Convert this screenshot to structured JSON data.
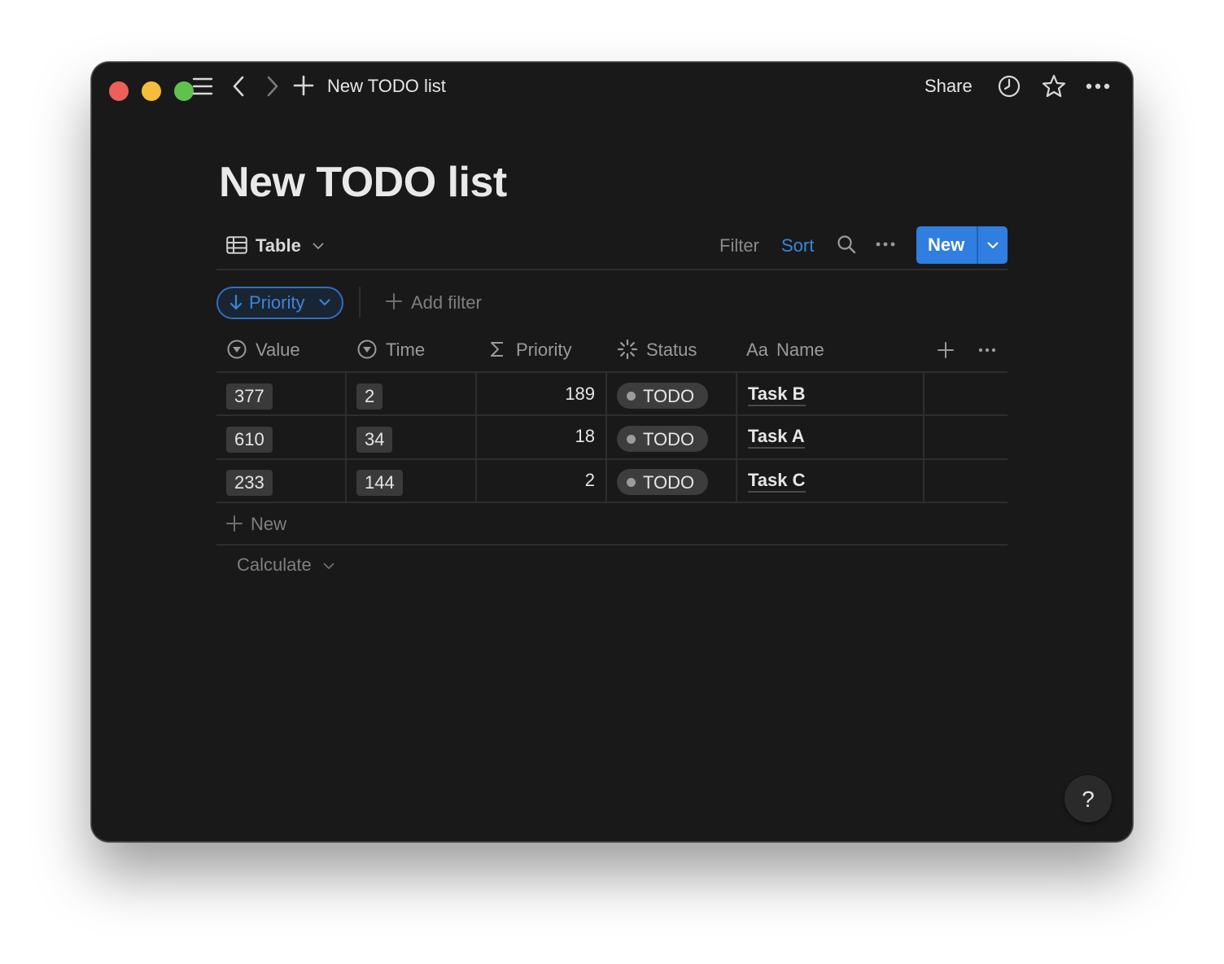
{
  "window": {
    "title": "New TODO list"
  },
  "titlebar": {
    "share_label": "Share"
  },
  "page": {
    "title": "New TODO list"
  },
  "view": {
    "label": "Table"
  },
  "toolbar": {
    "filter_label": "Filter",
    "sort_label": "Sort",
    "new_label": "New"
  },
  "sort_rule": {
    "label": "Priority",
    "direction": "descending"
  },
  "add_filter_label": "Add filter",
  "columns": [
    {
      "label": "Value",
      "icon": "formula-circle-icon"
    },
    {
      "label": "Time",
      "icon": "formula-circle-icon"
    },
    {
      "label": "Priority",
      "icon": "sigma-icon"
    },
    {
      "label": "Status",
      "icon": "status-spinner-icon"
    },
    {
      "label": "Name",
      "icon": "text-aa-icon",
      "icon_text": "Aa"
    }
  ],
  "rows": [
    {
      "value": "377",
      "time": "2",
      "priority": "189",
      "status": "TODO",
      "name": "Task B"
    },
    {
      "value": "610",
      "time": "34",
      "priority": "18",
      "status": "TODO",
      "name": "Task A"
    },
    {
      "value": "233",
      "time": "144",
      "priority": "2",
      "status": "TODO",
      "name": "Task C"
    }
  ],
  "new_row_label": "New",
  "calculate_label": "Calculate",
  "help_label": "?",
  "colors": {
    "accent": "#2f7ee0",
    "background": "#191919",
    "text": "#d4d4d4"
  }
}
